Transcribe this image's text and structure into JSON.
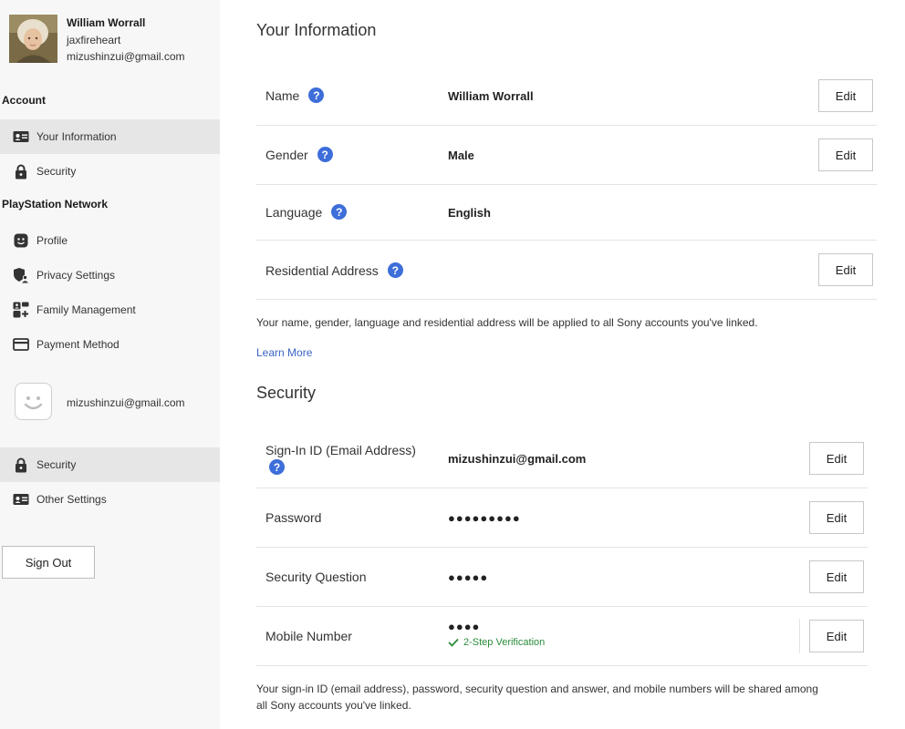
{
  "user": {
    "name": "William Worrall",
    "handle": "jaxfireheart",
    "email": "mizushinzui@gmail.com"
  },
  "sidebar": {
    "account_heading": "Account",
    "account_items": [
      {
        "label": "Your Information",
        "icon": "id-card-icon",
        "active": true
      },
      {
        "label": "Security",
        "icon": "lock-icon",
        "active": false
      }
    ],
    "psn_heading": "PlayStation Network",
    "psn_items": [
      {
        "label": "Profile",
        "icon": "face-icon"
      },
      {
        "label": "Privacy Settings",
        "icon": "shield-user-icon"
      },
      {
        "label": "Family Management",
        "icon": "family-icon"
      },
      {
        "label": "Payment Method",
        "icon": "credit-card-icon"
      }
    ],
    "psn_account_email": "mizushinzui@gmail.com",
    "psn_account_items": [
      {
        "label": "Security",
        "icon": "lock-icon",
        "active": true
      },
      {
        "label": "Other Settings",
        "icon": "id-card-icon",
        "active": false
      }
    ],
    "sign_out_label": "Sign Out"
  },
  "main": {
    "info_title": "Your Information",
    "info_rows": [
      {
        "label": "Name",
        "value": "William Worrall",
        "edit": "Edit"
      },
      {
        "label": "Gender",
        "value": "Male",
        "edit": "Edit"
      },
      {
        "label": "Language",
        "value": "English"
      },
      {
        "label": "Residential Address",
        "value": "",
        "edit": "Edit"
      }
    ],
    "info_note": "Your name, gender, language and residential address will be applied to all Sony accounts you've linked.",
    "learn_more": "Learn More",
    "security_title": "Security",
    "security_rows": [
      {
        "label": "Sign-In ID (Email Address)",
        "value": "mizushinzui@gmail.com",
        "edit": "Edit"
      },
      {
        "label": "Password",
        "value": "●●●●●●●●●",
        "edit": "Edit"
      },
      {
        "label": "Security Question",
        "value": "●●●●●",
        "edit": "Edit"
      },
      {
        "label": "Mobile Number",
        "value": "●●●●",
        "edit": "Edit"
      }
    ],
    "two_step_label": "2-Step Verification",
    "security_note_line1": "Your sign-in ID (email address), password, security question and answer, and mobile numbers will be shared among",
    "security_note_line2": "all Sony accounts you've linked."
  },
  "colors": {
    "help_badge": "#3d6ed9",
    "link": "#3b63c4",
    "success": "#2a8a3a",
    "sidebar_bg": "#f7f7f7",
    "active_item_bg": "#e6e6e6"
  }
}
